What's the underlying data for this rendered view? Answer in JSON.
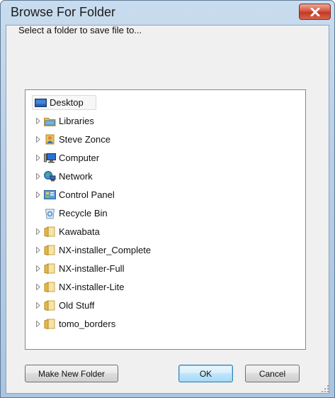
{
  "window": {
    "title": "Browse For Folder"
  },
  "dialog": {
    "instruction": "Select a folder to save file to...",
    "buttons": {
      "make_new_folder": "Make New Folder",
      "ok": "OK",
      "cancel": "Cancel"
    }
  },
  "tree": {
    "items": [
      {
        "label": "Desktop",
        "icon": "desktop-icon",
        "expandable": false,
        "selected": true
      },
      {
        "label": "Libraries",
        "icon": "libraries-icon",
        "expandable": true
      },
      {
        "label": "Steve Zonce",
        "icon": "user-folder-icon",
        "expandable": true
      },
      {
        "label": "Computer",
        "icon": "computer-icon",
        "expandable": true
      },
      {
        "label": "Network",
        "icon": "network-icon",
        "expandable": true
      },
      {
        "label": "Control Panel",
        "icon": "control-panel-icon",
        "expandable": true
      },
      {
        "label": "Recycle Bin",
        "icon": "recycle-bin-icon",
        "expandable": false
      },
      {
        "label": "Kawabata",
        "icon": "folder-icon",
        "expandable": true
      },
      {
        "label": "NX-installer_Complete",
        "icon": "folder-icon",
        "expandable": true
      },
      {
        "label": "NX-installer-Full",
        "icon": "folder-icon",
        "expandable": true
      },
      {
        "label": "NX-installer-Lite",
        "icon": "folder-icon",
        "expandable": true
      },
      {
        "label": "Old Stuff",
        "icon": "folder-icon",
        "expandable": true
      },
      {
        "label": "tomo_borders",
        "icon": "folder-icon",
        "expandable": true
      }
    ]
  },
  "colors": {
    "title_bar": "#b8cfe7",
    "close_button": "#c23a23",
    "client_background": "#f0f0f0",
    "default_button_border": "#3c7fb1"
  }
}
